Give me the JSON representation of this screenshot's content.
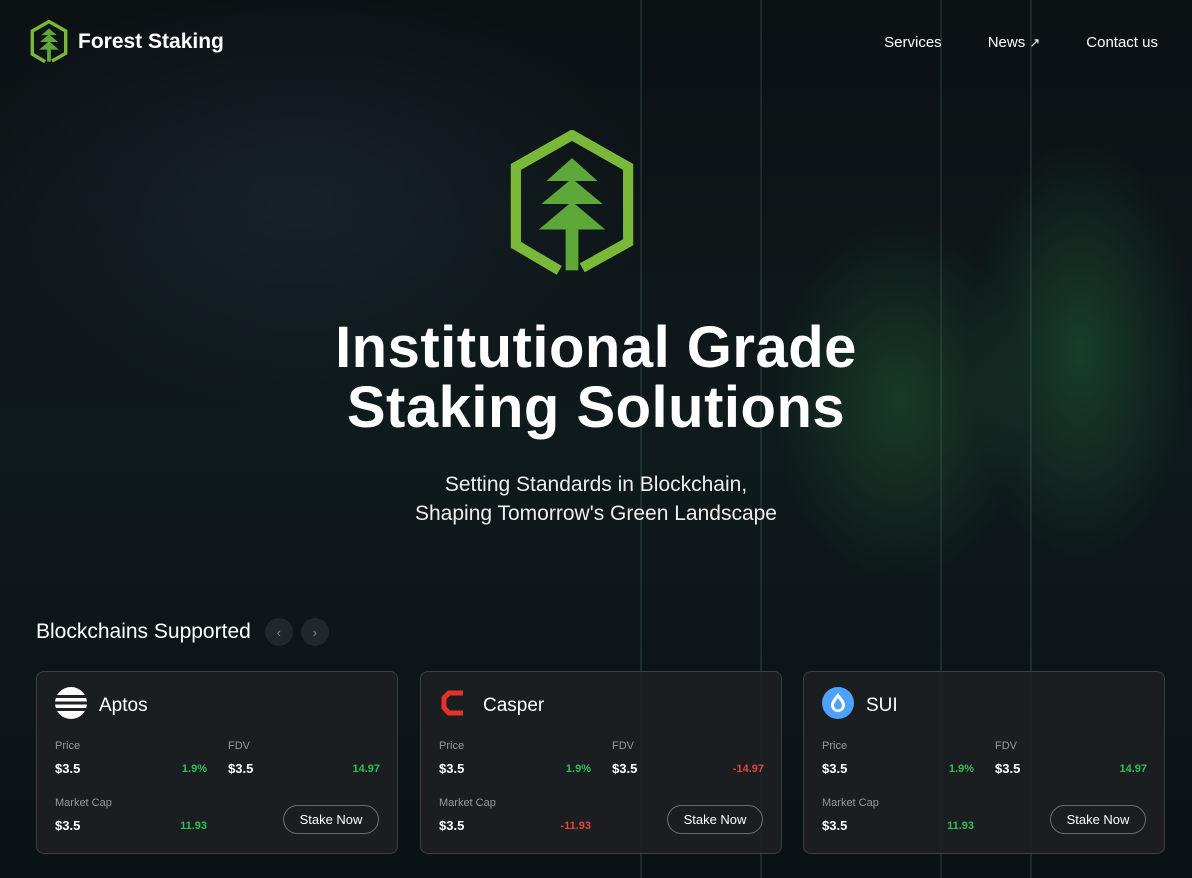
{
  "nav": {
    "brand": "Forest Staking",
    "links": [
      "Services",
      "News",
      "Contact us"
    ]
  },
  "hero": {
    "title_line1": "Institutional Grade",
    "title_line2": "Staking Solutions",
    "subtitle_line1": "Setting Standards in Blockchain,",
    "subtitle_line2": "Shaping Tomorrow's Green Landscape"
  },
  "section": {
    "title": "Blockchains Supported",
    "prev": "‹",
    "next": "›"
  },
  "labels": {
    "price": "Price",
    "fdv": "FDV",
    "market_cap": "Market Cap",
    "stake": "Stake Now"
  },
  "colors": {
    "accent": "#7ab83a",
    "positive": "#2fbf5a",
    "negative": "#e0443c"
  },
  "cards": [
    {
      "name": "Aptos",
      "icon": "aptos-icon",
      "price": "$3.5",
      "price_change": "1.9%",
      "fdv": "$3.5",
      "fdv_change": "14.97",
      "mcap": "$3.5",
      "mcap_change": "11.93"
    },
    {
      "name": "Casper",
      "icon": "casper-icon",
      "price": "$3.5",
      "price_change": "1.9%",
      "fdv": "$3.5",
      "fdv_change": "-14.97",
      "mcap": "$3.5",
      "mcap_change": "-11.93"
    },
    {
      "name": "SUI",
      "icon": "sui-icon",
      "price": "$3.5",
      "price_change": "1.9%",
      "fdv": "$3.5",
      "fdv_change": "14.97",
      "mcap": "$3.5",
      "mcap_change": "11.93"
    }
  ]
}
